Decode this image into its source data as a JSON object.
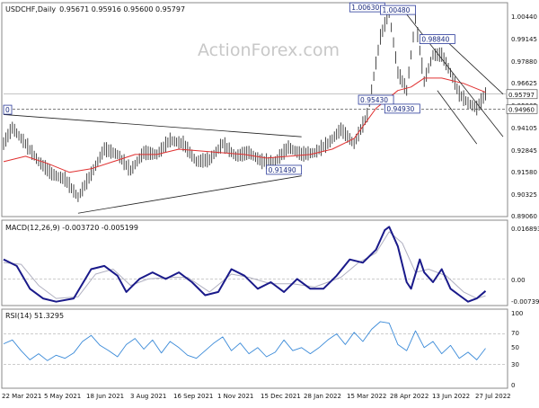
{
  "chart_data": {
    "type": "candlestick",
    "symbol_title": "USDCHF,Daily",
    "ohlc_text": "0.95671 0.95916 0.95600 0.95797",
    "watermark": "ActionForex.com",
    "x_tick_labels": [
      "22 Mar 2021",
      "5 May 2021",
      "18 Jun 2021",
      "3 Aug 2021",
      "16 Sep 2021",
      "1 Nov 2021",
      "15 Dec 2021",
      "28 Jan 2022",
      "15 Mar 2022",
      "28 Apr 2022",
      "13 Jun 2022",
      "27 Jul 2022"
    ],
    "main": {
      "ylim": [
        0.8896,
        1.0089
      ],
      "y_ticks": [
        "1.00440",
        "0.99145",
        "0.97880",
        "0.96625",
        "0.95365",
        "0.94105",
        "0.92845",
        "0.91580",
        "0.90325",
        "0.89060"
      ],
      "current_price": 0.95797,
      "current_price_label": "0.95797",
      "ref_price": 0.9496,
      "ref_price_label": "0.94960",
      "level_tags": [
        {
          "label": "1.00630",
          "x": 83,
          "y": 1.0063
        },
        {
          "label": "1.00480",
          "x": 90,
          "y": 1.0048
        },
        {
          "label": "0.98840",
          "x": 99,
          "y": 0.9884
        },
        {
          "label": "0.95430",
          "x": 85,
          "y": 0.9543
        },
        {
          "label": "0.94930",
          "x": 91,
          "y": 0.9493
        },
        {
          "label": "0.91490",
          "x": 64,
          "y": 0.9149
        },
        {
          "label": "0",
          "x": 0,
          "y": 0.9487
        }
      ],
      "close_series": [
        {
          "x": 0,
          "y": 0.93
        },
        {
          "x": 2,
          "y": 0.939
        },
        {
          "x": 5,
          "y": 0.93
        },
        {
          "x": 8,
          "y": 0.92
        },
        {
          "x": 11,
          "y": 0.913
        },
        {
          "x": 14,
          "y": 0.91
        },
        {
          "x": 17,
          "y": 0.9
        },
        {
          "x": 20,
          "y": 0.913
        },
        {
          "x": 23,
          "y": 0.927
        },
        {
          "x": 26,
          "y": 0.924
        },
        {
          "x": 29,
          "y": 0.915
        },
        {
          "x": 32,
          "y": 0.925
        },
        {
          "x": 35,
          "y": 0.924
        },
        {
          "x": 38,
          "y": 0.932
        },
        {
          "x": 41,
          "y": 0.93
        },
        {
          "x": 44,
          "y": 0.92
        },
        {
          "x": 47,
          "y": 0.921
        },
        {
          "x": 50,
          "y": 0.93
        },
        {
          "x": 53,
          "y": 0.923
        },
        {
          "x": 56,
          "y": 0.925
        },
        {
          "x": 59,
          "y": 0.92
        },
        {
          "x": 62,
          "y": 0.92
        },
        {
          "x": 65,
          "y": 0.928
        },
        {
          "x": 68,
          "y": 0.924
        },
        {
          "x": 71,
          "y": 0.925
        },
        {
          "x": 74,
          "y": 0.93
        },
        {
          "x": 77,
          "y": 0.938
        },
        {
          "x": 80,
          "y": 0.93
        },
        {
          "x": 83,
          "y": 0.946
        },
        {
          "x": 86,
          "y": 0.99
        },
        {
          "x": 88,
          "y": 1.004
        },
        {
          "x": 90,
          "y": 0.97
        },
        {
          "x": 92,
          "y": 0.96
        },
        {
          "x": 94,
          "y": 1.0
        },
        {
          "x": 96,
          "y": 0.965
        },
        {
          "x": 98,
          "y": 0.98
        },
        {
          "x": 100,
          "y": 0.98
        },
        {
          "x": 102,
          "y": 0.97
        },
        {
          "x": 104,
          "y": 0.958
        },
        {
          "x": 106,
          "y": 0.953
        },
        {
          "x": 108,
          "y": 0.95
        },
        {
          "x": 110,
          "y": 0.958
        }
      ],
      "ma_series": [
        {
          "x": 0,
          "y": 0.92
        },
        {
          "x": 5,
          "y": 0.923
        },
        {
          "x": 10,
          "y": 0.919
        },
        {
          "x": 15,
          "y": 0.914
        },
        {
          "x": 20,
          "y": 0.916
        },
        {
          "x": 25,
          "y": 0.92
        },
        {
          "x": 30,
          "y": 0.924
        },
        {
          "x": 35,
          "y": 0.924
        },
        {
          "x": 40,
          "y": 0.927
        },
        {
          "x": 45,
          "y": 0.926
        },
        {
          "x": 50,
          "y": 0.925
        },
        {
          "x": 55,
          "y": 0.924
        },
        {
          "x": 60,
          "y": 0.922
        },
        {
          "x": 65,
          "y": 0.923
        },
        {
          "x": 70,
          "y": 0.924
        },
        {
          "x": 75,
          "y": 0.927
        },
        {
          "x": 80,
          "y": 0.933
        },
        {
          "x": 85,
          "y": 0.95
        },
        {
          "x": 90,
          "y": 0.96
        },
        {
          "x": 93,
          "y": 0.962
        },
        {
          "x": 96,
          "y": 0.967
        },
        {
          "x": 100,
          "y": 0.967
        },
        {
          "x": 105,
          "y": 0.964
        },
        {
          "x": 110,
          "y": 0.959
        }
      ],
      "trendlines": [
        {
          "x1": 0,
          "y1": 0.9465,
          "x2": 68,
          "y2": 0.934
        },
        {
          "x1": 17,
          "y1": 0.891,
          "x2": 68,
          "y2": 0.912
        },
        {
          "x1": 91,
          "y1": 1.006,
          "x2": 114,
          "y2": 0.934
        },
        {
          "x1": 101,
          "y1": 0.988,
          "x2": 114,
          "y2": 0.958
        },
        {
          "x1": 99,
          "y1": 0.96,
          "x2": 108,
          "y2": 0.93
        }
      ]
    },
    "macd": {
      "label": "MACD(12,26,9) -0.003720 -0.005199",
      "ylim": [
        -0.0079,
        0.0175
      ],
      "y_ticks": [
        "0.016893",
        "0.00",
        "-0.007393"
      ],
      "macd_series": [
        {
          "x": 0,
          "y": 0.006
        },
        {
          "x": 3,
          "y": 0.004
        },
        {
          "x": 6,
          "y": -0.003
        },
        {
          "x": 9,
          "y": -0.006
        },
        {
          "x": 12,
          "y": -0.007
        },
        {
          "x": 16,
          "y": -0.006
        },
        {
          "x": 20,
          "y": 0.003
        },
        {
          "x": 23,
          "y": 0.004
        },
        {
          "x": 26,
          "y": 0.001
        },
        {
          "x": 28,
          "y": -0.004
        },
        {
          "x": 31,
          "y": 0.0
        },
        {
          "x": 34,
          "y": 0.002
        },
        {
          "x": 37,
          "y": 0.0
        },
        {
          "x": 40,
          "y": 0.002
        },
        {
          "x": 43,
          "y": -0.001
        },
        {
          "x": 46,
          "y": -0.005
        },
        {
          "x": 49,
          "y": -0.004
        },
        {
          "x": 52,
          "y": 0.003
        },
        {
          "x": 55,
          "y": 0.001
        },
        {
          "x": 58,
          "y": -0.003
        },
        {
          "x": 61,
          "y": -0.001
        },
        {
          "x": 64,
          "y": -0.004
        },
        {
          "x": 67,
          "y": 0.0
        },
        {
          "x": 70,
          "y": -0.003
        },
        {
          "x": 73,
          "y": -0.003
        },
        {
          "x": 76,
          "y": 0.001
        },
        {
          "x": 79,
          "y": 0.006
        },
        {
          "x": 82,
          "y": 0.005
        },
        {
          "x": 85,
          "y": 0.009
        },
        {
          "x": 87,
          "y": 0.015
        },
        {
          "x": 88,
          "y": 0.016
        },
        {
          "x": 90,
          "y": 0.01
        },
        {
          "x": 92,
          "y": -0.001
        },
        {
          "x": 93,
          "y": -0.003
        },
        {
          "x": 95,
          "y": 0.006
        },
        {
          "x": 96,
          "y": 0.002
        },
        {
          "x": 98,
          "y": -0.001
        },
        {
          "x": 100,
          "y": 0.003
        },
        {
          "x": 102,
          "y": -0.003
        },
        {
          "x": 104,
          "y": -0.005
        },
        {
          "x": 106,
          "y": -0.007
        },
        {
          "x": 108,
          "y": -0.006
        },
        {
          "x": 110,
          "y": -0.0037
        }
      ],
      "signal_series": [
        {
          "x": 0,
          "y": 0.005
        },
        {
          "x": 4,
          "y": 0.0045
        },
        {
          "x": 8,
          "y": -0.002
        },
        {
          "x": 12,
          "y": -0.006
        },
        {
          "x": 17,
          "y": -0.0055
        },
        {
          "x": 21,
          "y": 0.0015
        },
        {
          "x": 25,
          "y": 0.003
        },
        {
          "x": 29,
          "y": -0.002
        },
        {
          "x": 33,
          "y": 0.0
        },
        {
          "x": 38,
          "y": 0.0005
        },
        {
          "x": 42,
          "y": 0.0005
        },
        {
          "x": 47,
          "y": -0.004
        },
        {
          "x": 52,
          "y": 0.0015
        },
        {
          "x": 56,
          "y": 0.0005
        },
        {
          "x": 61,
          "y": -0.0015
        },
        {
          "x": 66,
          "y": -0.0015
        },
        {
          "x": 71,
          "y": -0.0025
        },
        {
          "x": 77,
          "y": 0.0005
        },
        {
          "x": 81,
          "y": 0.005
        },
        {
          "x": 85,
          "y": 0.008
        },
        {
          "x": 88,
          "y": 0.0145
        },
        {
          "x": 91,
          "y": 0.011
        },
        {
          "x": 94,
          "y": 0.002
        },
        {
          "x": 97,
          "y": 0.003
        },
        {
          "x": 101,
          "y": 0.001
        },
        {
          "x": 105,
          "y": -0.004
        },
        {
          "x": 108,
          "y": -0.006
        },
        {
          "x": 110,
          "y": -0.0052
        }
      ]
    },
    "rsi": {
      "label": "RSI(14) 51.3295",
      "ylim": [
        0,
        100
      ],
      "y_ticks": [
        "100",
        "70",
        "50",
        "30",
        "0"
      ],
      "levels": [
        70,
        30
      ],
      "series": [
        {
          "x": 0,
          "y": 57
        },
        {
          "x": 2,
          "y": 62
        },
        {
          "x": 4,
          "y": 48
        },
        {
          "x": 6,
          "y": 36
        },
        {
          "x": 8,
          "y": 44
        },
        {
          "x": 10,
          "y": 35
        },
        {
          "x": 12,
          "y": 42
        },
        {
          "x": 14,
          "y": 38
        },
        {
          "x": 16,
          "y": 45
        },
        {
          "x": 18,
          "y": 60
        },
        {
          "x": 20,
          "y": 68
        },
        {
          "x": 22,
          "y": 55
        },
        {
          "x": 24,
          "y": 48
        },
        {
          "x": 26,
          "y": 40
        },
        {
          "x": 28,
          "y": 56
        },
        {
          "x": 30,
          "y": 64
        },
        {
          "x": 32,
          "y": 50
        },
        {
          "x": 34,
          "y": 62
        },
        {
          "x": 36,
          "y": 45
        },
        {
          "x": 38,
          "y": 60
        },
        {
          "x": 40,
          "y": 52
        },
        {
          "x": 42,
          "y": 42
        },
        {
          "x": 44,
          "y": 38
        },
        {
          "x": 46,
          "y": 48
        },
        {
          "x": 48,
          "y": 58
        },
        {
          "x": 50,
          "y": 66
        },
        {
          "x": 52,
          "y": 48
        },
        {
          "x": 54,
          "y": 58
        },
        {
          "x": 56,
          "y": 44
        },
        {
          "x": 58,
          "y": 52
        },
        {
          "x": 60,
          "y": 40
        },
        {
          "x": 62,
          "y": 46
        },
        {
          "x": 64,
          "y": 62
        },
        {
          "x": 66,
          "y": 48
        },
        {
          "x": 68,
          "y": 52
        },
        {
          "x": 70,
          "y": 44
        },
        {
          "x": 72,
          "y": 52
        },
        {
          "x": 74,
          "y": 62
        },
        {
          "x": 76,
          "y": 70
        },
        {
          "x": 78,
          "y": 56
        },
        {
          "x": 80,
          "y": 72
        },
        {
          "x": 82,
          "y": 60
        },
        {
          "x": 84,
          "y": 76
        },
        {
          "x": 86,
          "y": 86
        },
        {
          "x": 88,
          "y": 84
        },
        {
          "x": 90,
          "y": 56
        },
        {
          "x": 92,
          "y": 48
        },
        {
          "x": 94,
          "y": 74
        },
        {
          "x": 96,
          "y": 52
        },
        {
          "x": 98,
          "y": 60
        },
        {
          "x": 100,
          "y": 44
        },
        {
          "x": 102,
          "y": 55
        },
        {
          "x": 104,
          "y": 38
        },
        {
          "x": 106,
          "y": 46
        },
        {
          "x": 108,
          "y": 36
        },
        {
          "x": 110,
          "y": 51
        }
      ]
    }
  }
}
